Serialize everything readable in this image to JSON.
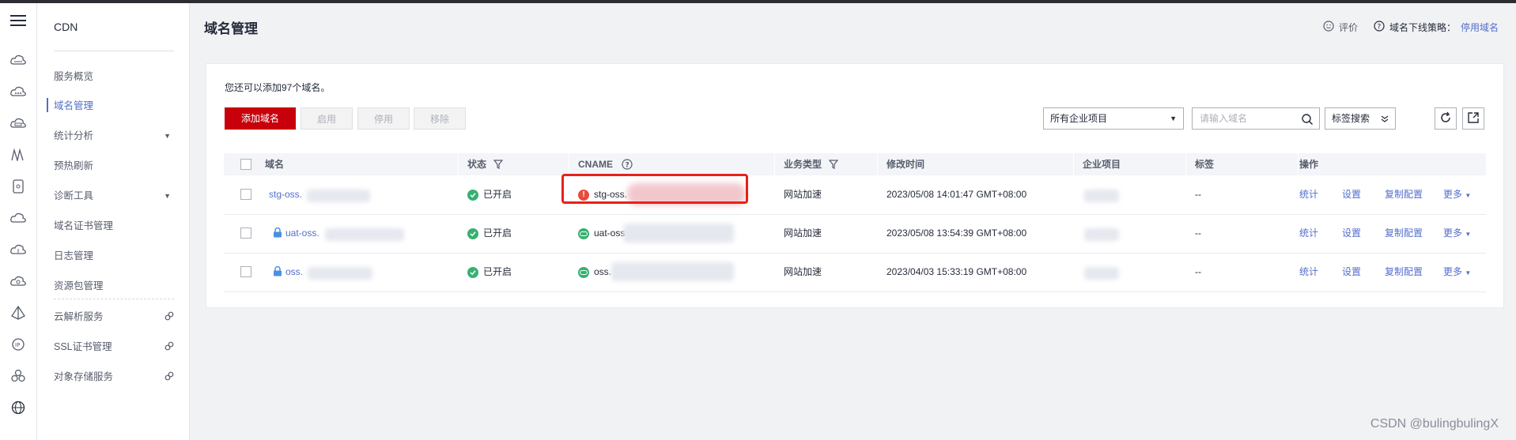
{
  "nav": {
    "title": "CDN",
    "items": [
      {
        "label": "服务概览"
      },
      {
        "label": "域名管理"
      },
      {
        "label": "统计分析"
      },
      {
        "label": "预热刷新"
      },
      {
        "label": "诊断工具"
      },
      {
        "label": "域名证书管理"
      },
      {
        "label": "日志管理"
      },
      {
        "label": "资源包管理"
      },
      {
        "label": "云解析服务"
      },
      {
        "label": "SSL证书管理"
      },
      {
        "label": "对象存储服务"
      }
    ]
  },
  "header": {
    "title": "域名管理",
    "feedback": "评价",
    "policy_label": "域名下线策略：",
    "policy_link": "停用域名"
  },
  "toolbar": {
    "quota_text": "您还可以添加97个域名。",
    "add_label": "添加域名",
    "enable_label": "启用",
    "disable_label": "停用",
    "remove_label": "移除",
    "project_select": "所有企业项目",
    "search_placeholder": "请输入域名",
    "tag_search": "标签搜索"
  },
  "table": {
    "headers": [
      "域名",
      "状态",
      "CNAME",
      "业务类型",
      "修改时间",
      "企业项目",
      "标签",
      "操作"
    ],
    "rows": [
      {
        "domain": "stg-oss.",
        "status": "已开启",
        "cname": "stg-oss.",
        "cname_state": "error",
        "type": "网站加速",
        "time": "2023/05/08 14:01:47 GMT+08:00",
        "tag": "--",
        "lock": false
      },
      {
        "domain": "uat-oss.",
        "status": "已开启",
        "cname": "uat-oss",
        "cname_state": "ok",
        "type": "网站加速",
        "time": "2023/05/08 13:54:39 GMT+08:00",
        "tag": "--",
        "lock": true
      },
      {
        "domain": "oss.",
        "status": "已开启",
        "cname": "oss.",
        "cname_state": "ok",
        "type": "网站加速",
        "time": "2023/04/03 15:33:19 GMT+08:00",
        "tag": "--",
        "lock": true
      }
    ],
    "actions": {
      "stats": "统计",
      "settings": "设置",
      "copy": "复制配置",
      "more": "更多"
    }
  },
  "watermark": "CSDN @bulingbulingX",
  "colors": {
    "brand_red": "#c7000b",
    "link_blue": "#526ecc",
    "ok_green": "#37b172",
    "error_red": "#e74c3c"
  }
}
